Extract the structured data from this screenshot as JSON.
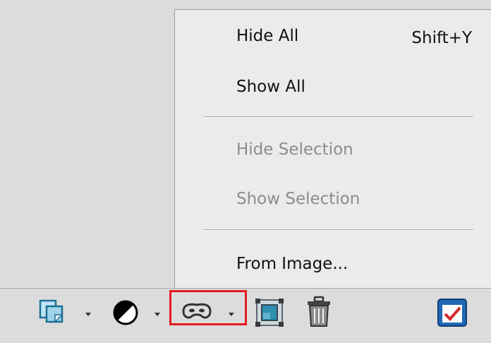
{
  "menu": {
    "items": [
      {
        "label": "Hide All",
        "shortcut": "Shift+Y",
        "enabled": true
      },
      {
        "label": "Show All",
        "enabled": true
      },
      {
        "label": "Hide Selection",
        "enabled": false
      },
      {
        "label": "Show Selection",
        "enabled": false
      },
      {
        "label": "From Image...",
        "enabled": true
      }
    ]
  },
  "toolbar": {
    "icons": [
      "new-layer-icon",
      "adjustment-icon",
      "mask-icon",
      "fit-to-canvas-icon",
      "trash-icon",
      "preview-check-icon"
    ]
  },
  "colors": {
    "menu_bg": "#ebebeb",
    "toolbar_bg": "#dcdcdc",
    "highlight": "#e21b23",
    "disabled_text": "#8c8c8c"
  }
}
